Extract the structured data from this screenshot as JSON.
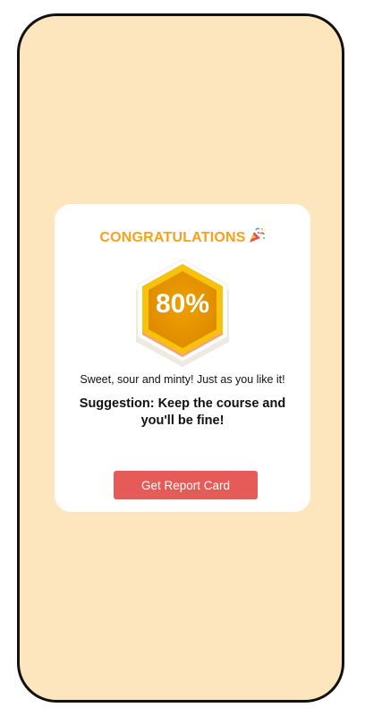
{
  "card": {
    "title": "CONGRATULATIONS",
    "title_icon": "party-popper-icon",
    "score": "80%",
    "message": "Sweet, sour and minty! Just as you like it!",
    "suggestion": "Suggestion: Keep the course and you'll be fine!",
    "button_label": "Get Report Card"
  },
  "colors": {
    "background": "#fde5bd",
    "title": "#f3a21b",
    "badge_fill": "#e69500",
    "button": "#e65a57",
    "card": "#ffffff"
  }
}
